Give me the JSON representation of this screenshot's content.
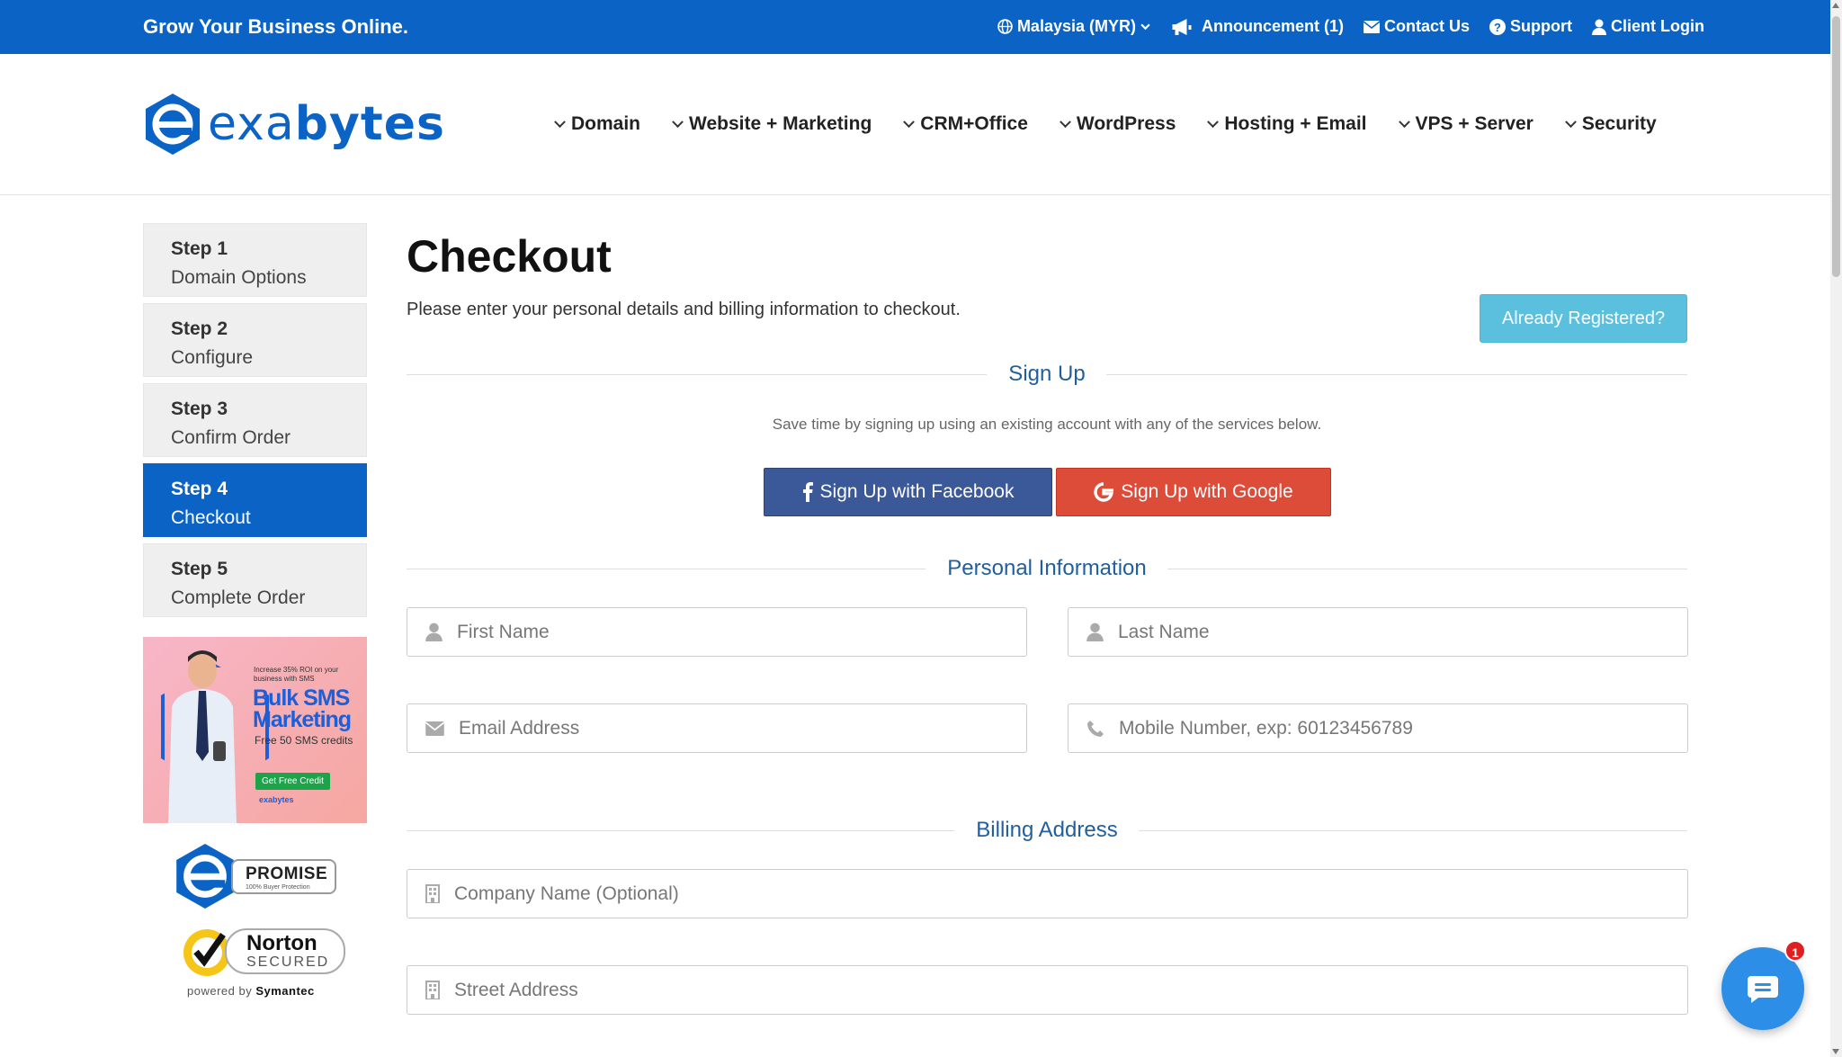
{
  "topbar": {
    "tagline": "Grow Your Business Online.",
    "region": "Malaysia (MYR)",
    "announcement": "Announcement (1)",
    "contact": "Contact Us",
    "support": "Support",
    "client_login": "Client Login"
  },
  "logo": {
    "part1": "exa",
    "part2": "bytes"
  },
  "nav": [
    "Domain",
    "Website + Marketing",
    "CRM+Office",
    "WordPress",
    "Hosting + Email",
    "VPS + Server",
    "Security"
  ],
  "steps": [
    {
      "num": "Step 1",
      "label": "Domain Options"
    },
    {
      "num": "Step 2",
      "label": "Configure"
    },
    {
      "num": "Step 3",
      "label": "Confirm Order"
    },
    {
      "num": "Step 4",
      "label": "Checkout"
    },
    {
      "num": "Step 5",
      "label": "Complete Order"
    }
  ],
  "banner": {
    "small": "Increase 35% ROI on your business with SMS",
    "big1": "Bulk SMS",
    "big2": "Marketing",
    "free": "Free 50 SMS credits",
    "cta": "Get Free Credit",
    "brand": "exabytes"
  },
  "promise": {
    "title": "PROMISE",
    "sub": "100% Buyer Protection"
  },
  "norton": {
    "title": "Norton",
    "sub": "SECURED",
    "powered_pre": "powered by",
    "powered_brand": "Symantec"
  },
  "main": {
    "title": "Checkout",
    "subtitle": "Please enter your personal details and billing information to checkout.",
    "already_registered": "Already Registered?"
  },
  "signup": {
    "heading": "Sign Up",
    "note": "Save time by signing up using an existing account with any of the services below.",
    "facebook": "Sign Up with Facebook",
    "google": "Sign Up with Google"
  },
  "personal": {
    "heading": "Personal Information",
    "first_name": "First Name",
    "last_name": "Last Name",
    "email": "Email Address",
    "mobile": "Mobile Number, exp: 60123456789"
  },
  "billing": {
    "heading": "Billing Address",
    "company": "Company Name (Optional)",
    "street": "Street Address"
  },
  "chat": {
    "badge": "1"
  },
  "colors": {
    "brand": "#0a63c5",
    "facebook": "#3b5998",
    "google": "#dd4b39",
    "info": "#5bc0de"
  }
}
